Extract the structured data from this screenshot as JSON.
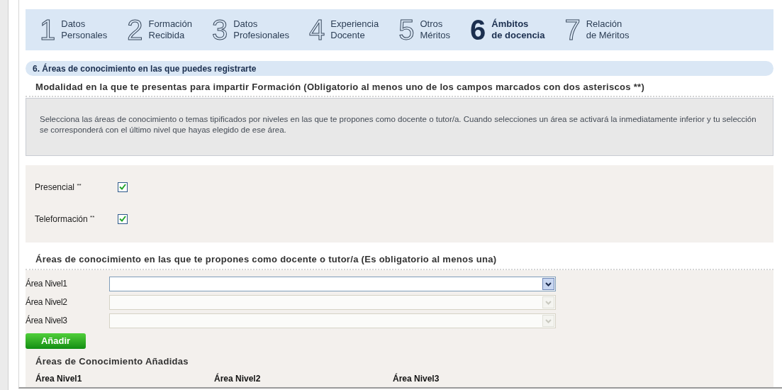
{
  "steps": [
    {
      "number": "1",
      "line1": "Datos",
      "line2": "Personales",
      "selected": false
    },
    {
      "number": "2",
      "line1": "Formación",
      "line2": "Recibida",
      "selected": false
    },
    {
      "number": "3",
      "line1": "Datos",
      "line2": "Profesionales",
      "selected": false
    },
    {
      "number": "4",
      "line1": "Experiencia",
      "line2": "Docente",
      "selected": false
    },
    {
      "number": "5",
      "line1": "Otros",
      "line2": "Méritos",
      "selected": false
    },
    {
      "number": "6",
      "line1": "Ámbitos",
      "line2": "de docencia",
      "selected": true
    },
    {
      "number": "7",
      "line1": "Relación",
      "line2": "de Méritos",
      "selected": false
    }
  ],
  "section_title": "6. Áreas de conocimiento en las que puedes registrarte",
  "modalidad": {
    "heading": "Modalidad en la que te presentas para impartir Formación (Obligatorio al menos uno de los campos marcados con dos asteriscos **)",
    "info": "Selecciona las áreas de conocimiento o temas tipificados por niveles en las que te propones como docente o tutor/a. Cuando selecciones un área se activará la inmediatamente inferior y tu selección se corresponderá con el último nivel que hayas elegido de ese área.",
    "options": [
      {
        "label": "Presencial",
        "mark": "**",
        "checked": true
      },
      {
        "label": "Teleformación",
        "mark": "**",
        "checked": true
      }
    ]
  },
  "areas": {
    "heading": "Áreas de conocimiento en las que te propones como docente o tutor/a (Es obligatorio al menos una)",
    "fields": [
      {
        "label": "Área Nivel1",
        "disabled": false
      },
      {
        "label": "Área Nivel2",
        "disabled": true
      },
      {
        "label": "Área Nivel3",
        "disabled": true
      }
    ],
    "add_button": "Añadir",
    "added_title": "Áreas de Conocimiento Añadidas",
    "columns": [
      "Área Nivel1",
      "Área Nivel2",
      "Área Nivel3"
    ]
  }
}
